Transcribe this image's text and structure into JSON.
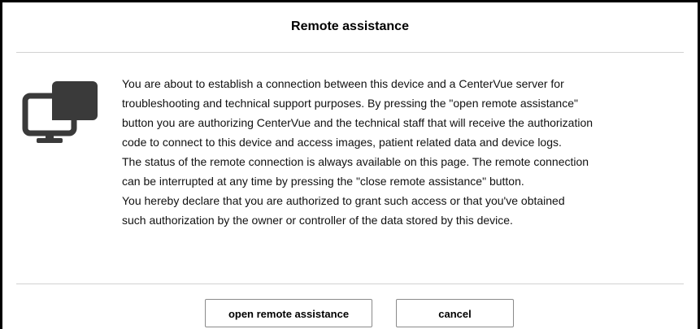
{
  "dialog": {
    "title": "Remote assistance",
    "icon": "remote-monitors-icon",
    "paragraphs": [
      "You are about to establish a connection between this device and a CenterVue server for",
      "troubleshooting and technical support purposes. By pressing the \"open remote assistance\"",
      "button you are authorizing CenterVue and the technical staff that will receive the authorization",
      "code to connect to this device and access images, patient related data and device logs.",
      "The status of the remote connection is always available on this page. The remote connection",
      "can be interrupted at any time by pressing the \"close remote assistance\" button.",
      "You hereby declare that you are authorized to grant such access or that you've obtained",
      "such authorization by the owner or controller of the data stored by this device."
    ],
    "buttons": {
      "open_label": "open remote assistance",
      "cancel_label": "cancel"
    }
  }
}
